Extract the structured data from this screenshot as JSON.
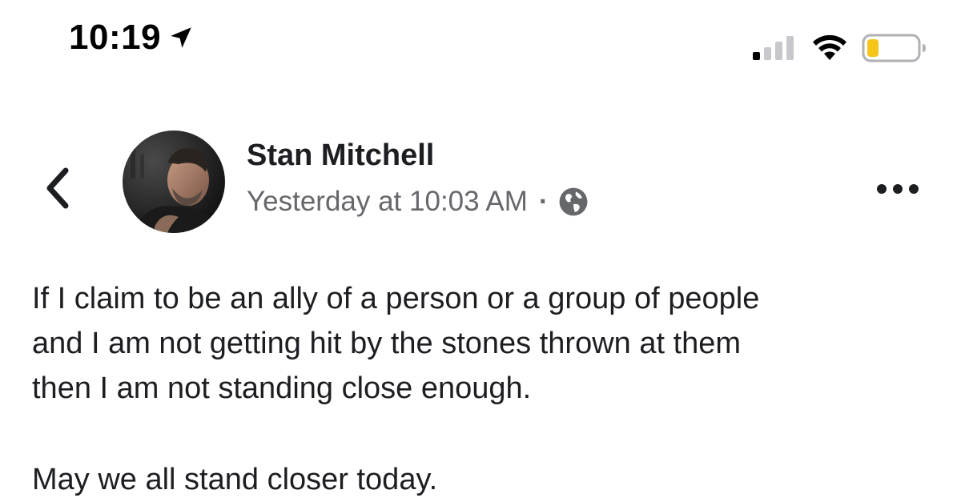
{
  "status_bar": {
    "time": "10:19",
    "signal_icon": "cellular-signal-icon",
    "wifi_icon": "wifi-icon",
    "battery_icon": "battery-low-icon",
    "battery_color": "#f5c518"
  },
  "post": {
    "author": "Stan Mitchell",
    "timestamp": "Yesterday at 10:03 AM",
    "separator": "·",
    "privacy_icon": "globe-icon",
    "paragraphs": [
      {
        "lines": [
          "If I claim to be an ally of a person or a group of people",
          "and I am not getting hit by the stones thrown at them",
          "then I am not standing close enough."
        ]
      },
      {
        "lines": [
          "May we all stand closer today."
        ]
      }
    ]
  },
  "nav": {
    "back_icon": "chevron-left-icon",
    "more_icon": "more-options-icon"
  },
  "colors": {
    "text": "#1c1e21",
    "secondary_text": "#65676b"
  }
}
